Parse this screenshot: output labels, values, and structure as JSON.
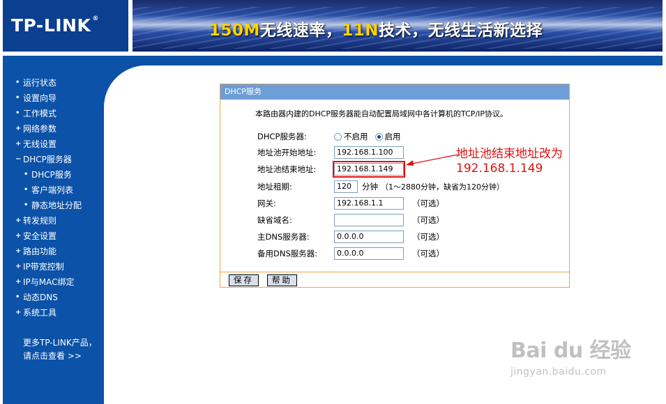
{
  "header": {
    "logo": "TP-LINK",
    "logo_reg": "®",
    "banner_part1": "150M",
    "banner_part2": "无线速率，",
    "banner_part3": "11N",
    "banner_part4": "技术，无线生活新选择"
  },
  "sidebar": {
    "items": [
      {
        "bullet": "•",
        "label": "运行状态"
      },
      {
        "bullet": "•",
        "label": "设置向导"
      },
      {
        "bullet": "•",
        "label": "工作模式"
      },
      {
        "bullet": "+",
        "label": "网络参数"
      },
      {
        "bullet": "+",
        "label": "无线设置"
      },
      {
        "bullet": "−",
        "label": "DHCP服务器"
      },
      {
        "bullet": "•",
        "label": "DHCP服务"
      },
      {
        "bullet": "•",
        "label": "客户端列表"
      },
      {
        "bullet": "•",
        "label": "静态地址分配"
      },
      {
        "bullet": "+",
        "label": "转发规则"
      },
      {
        "bullet": "+",
        "label": "安全设置"
      },
      {
        "bullet": "+",
        "label": "路由功能"
      },
      {
        "bullet": "+",
        "label": "IP带宽控制"
      },
      {
        "bullet": "+",
        "label": "IP与MAC绑定"
      },
      {
        "bullet": "•",
        "label": "动态DNS"
      },
      {
        "bullet": "+",
        "label": "系统工具"
      }
    ],
    "more_line1": "更多TP-LINK产品，",
    "more_line2": "请点击查看 >>"
  },
  "panel": {
    "title": "DHCP服务",
    "intro": "本路由器内建的DHCP服务器能自动配置局域网中各计算机的TCP/IP协议。",
    "dhcp_label": "DHCP服务器:",
    "opt_off": "不启用",
    "opt_on": "启用",
    "start_label": "地址池开始地址:",
    "start_value": "192.168.1.100",
    "end_label": "地址池结束地址:",
    "end_value": "192.168.1.149",
    "lease_label": "地址租期:",
    "lease_value": "120",
    "lease_unit": "分钟",
    "lease_hint": "（1～2880分钟，缺省为120分钟）",
    "gateway_label": "网关:",
    "gateway_value": "192.168.1.1",
    "domain_label": "缺省域名:",
    "domain_value": "",
    "dns1_label": "主DNS服务器:",
    "dns1_value": "0.0.0.0",
    "dns2_label": "备用DNS服务器:",
    "dns2_value": "0.0.0.0",
    "optional": "（可选）",
    "save_button": "保存",
    "help_button": "帮助"
  },
  "annotation": {
    "line1": "地址池结束地址改为",
    "line2": "192.168.1.149",
    "color": "#e01010"
  },
  "watermark": {
    "logo": "Bai du 经验",
    "url": "jingyan.baidu.com"
  }
}
